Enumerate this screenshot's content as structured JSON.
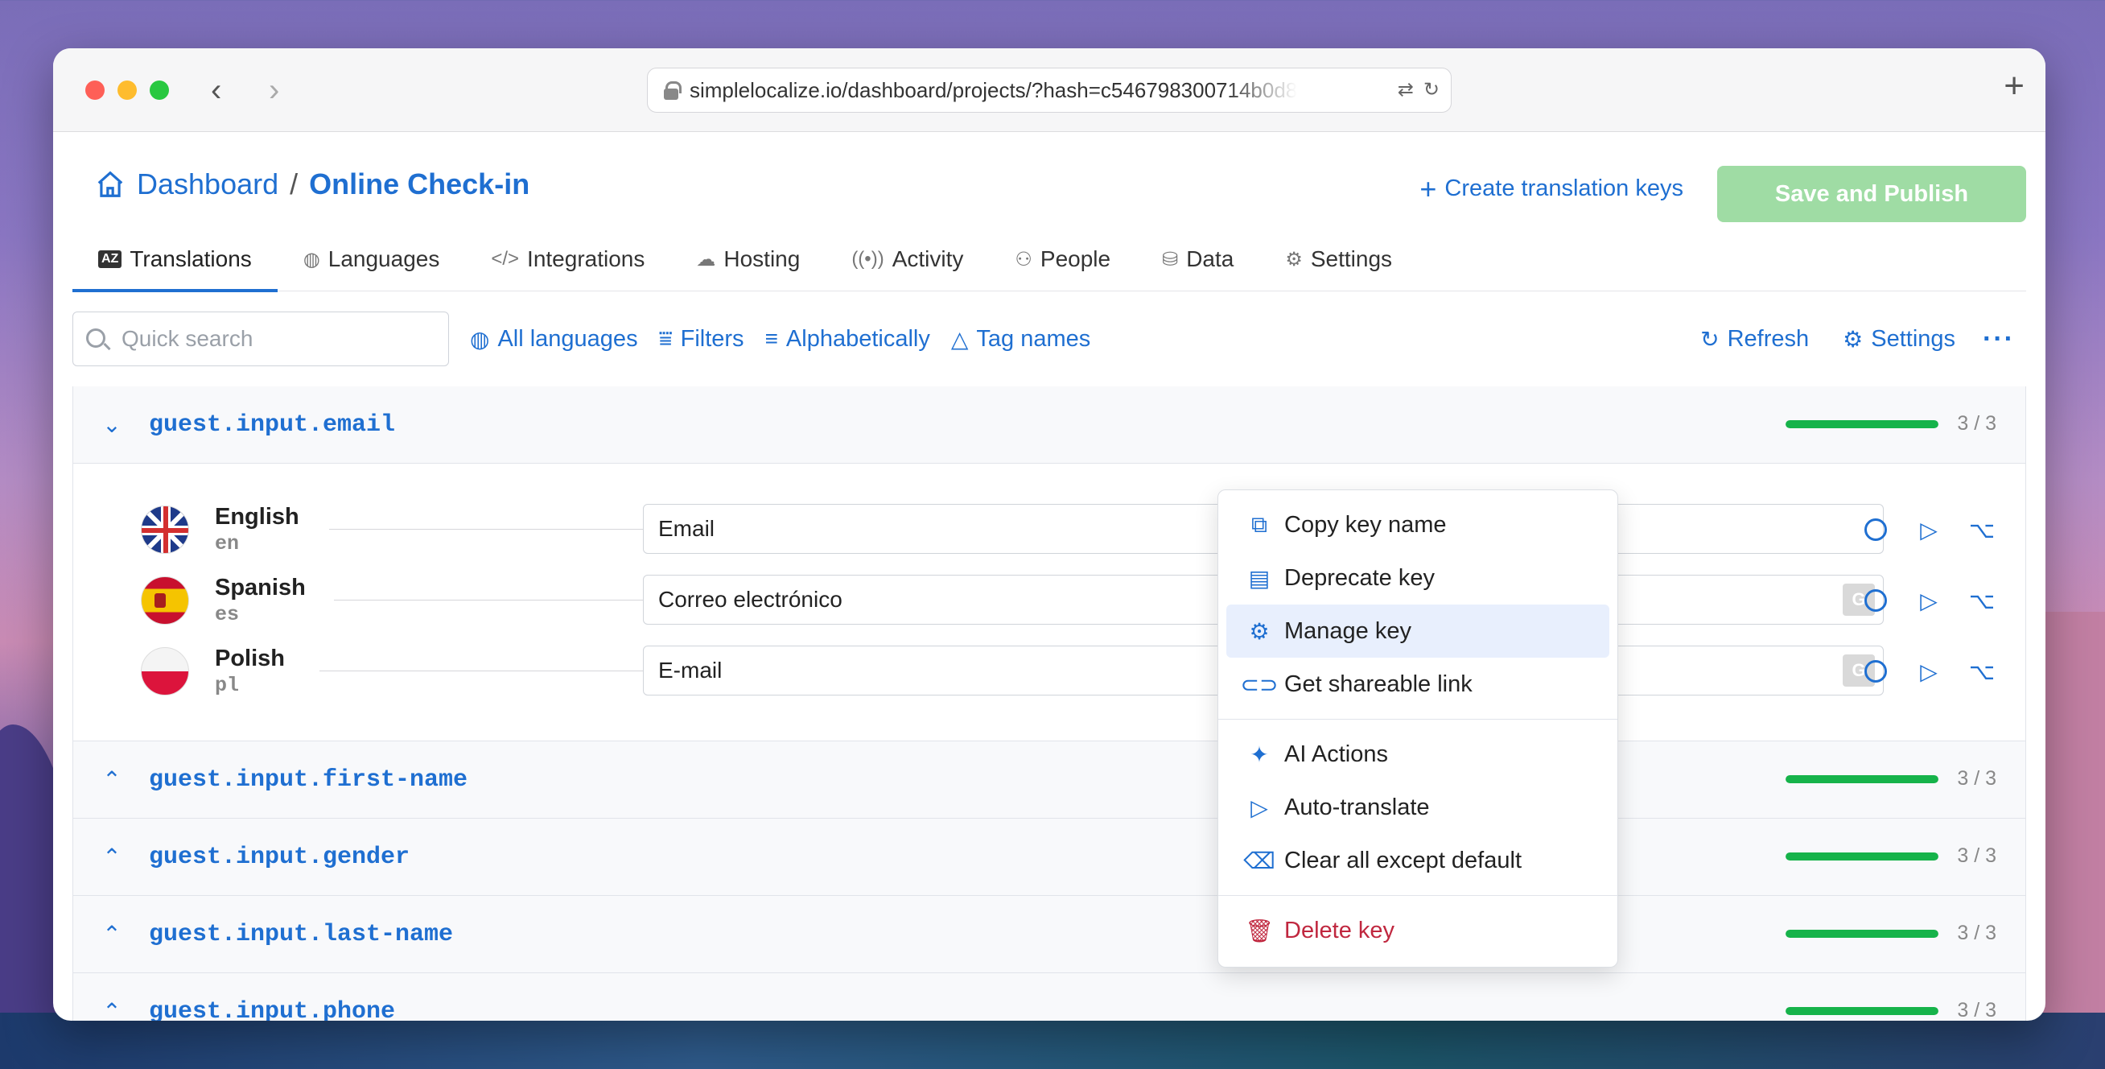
{
  "browser": {
    "url": "simplelocalize.io/dashboard/projects/?hash=c546798300714b0d8"
  },
  "header": {
    "breadcrumb_root": "Dashboard",
    "breadcrumb_sep": "/",
    "breadcrumb_current": "Online Check-in",
    "create_keys_label": "Create translation keys",
    "save_publish_label": "Save and Publish"
  },
  "tabs": [
    {
      "label": "Translations",
      "icon": "az-icon"
    },
    {
      "label": "Languages",
      "icon": "globe-icon"
    },
    {
      "label": "Integrations",
      "icon": "code-icon"
    },
    {
      "label": "Hosting",
      "icon": "cloud-icon"
    },
    {
      "label": "Activity",
      "icon": "broadcast-icon"
    },
    {
      "label": "People",
      "icon": "people-icon"
    },
    {
      "label": "Data",
      "icon": "database-icon"
    },
    {
      "label": "Settings",
      "icon": "gear-icon"
    }
  ],
  "toolbar": {
    "search_placeholder": "Quick search",
    "all_languages": "All languages",
    "filters": "Filters",
    "sort": "Alphabetically",
    "tag_names": "Tag names",
    "refresh": "Refresh",
    "settings": "Settings"
  },
  "keys": [
    {
      "name": "guest.input.email",
      "progress": "3 / 3",
      "expanded": true
    },
    {
      "name": "guest.input.first-name",
      "progress": "3 / 3"
    },
    {
      "name": "guest.input.gender",
      "progress": "3 / 3"
    },
    {
      "name": "guest.input.last-name",
      "progress": "3 / 3"
    },
    {
      "name": "guest.input.phone",
      "progress": "3 / 3"
    }
  ],
  "translations": [
    {
      "language": "English",
      "code": "en",
      "value": "Email"
    },
    {
      "language": "Spanish",
      "code": "es",
      "value": "Correo electrónico"
    },
    {
      "language": "Polish",
      "code": "pl",
      "value": "E-mail"
    }
  ],
  "context_menu": {
    "copy_key_name": "Copy key name",
    "deprecate_key": "Deprecate key",
    "manage_key": "Manage key",
    "get_shareable_link": "Get shareable link",
    "ai_actions": "AI Actions",
    "auto_translate": "Auto-translate",
    "clear_all_except_default": "Clear all except default",
    "delete_key": "Delete key"
  },
  "colors": {
    "accent": "#1f6fd1",
    "progress": "#16b34a",
    "save_button": "#9fdca4",
    "danger": "#c0273f",
    "menu_highlight": "#e8effd"
  }
}
